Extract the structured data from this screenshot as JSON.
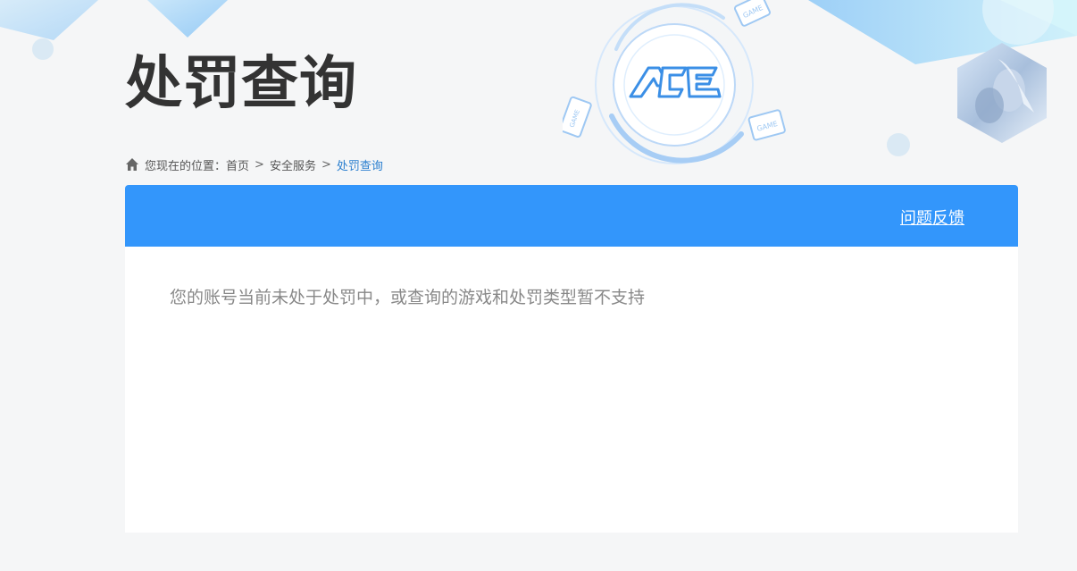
{
  "page": {
    "title": "处罚查询"
  },
  "breadcrumb": {
    "prefix": "您现在的位置：",
    "items": [
      "首页",
      "安全服务"
    ],
    "separator": ">",
    "current": "处罚查询"
  },
  "panel": {
    "feedback_label": "问题反馈",
    "message": "您的账号当前未处于处罚中，或查询的游戏和处罚类型暂不支持"
  },
  "decor": {
    "logo_text": "ACE",
    "device_label": "GAME"
  },
  "colors": {
    "accent": "#3396fb",
    "title": "#333333",
    "link_current": "#2b7fcf",
    "message": "#888888",
    "background": "#f5f6f7"
  },
  "icons": {
    "breadcrumb": "home-icon"
  }
}
